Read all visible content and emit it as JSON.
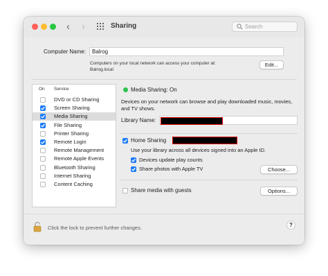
{
  "window": {
    "title": "Sharing"
  },
  "toolbar": {
    "back_icon": "‹",
    "forward_icon": "›"
  },
  "search": {
    "placeholder": "Search"
  },
  "computer_name": {
    "label": "Computer Name:",
    "value": "Balrog",
    "description_line1": "Computers on your local network can access your computer at:",
    "description_line2": "Balrog.local",
    "edit_button": "Edit..."
  },
  "services": {
    "col_on": "On",
    "col_service": "Service",
    "items": [
      {
        "label": "DVD or CD Sharing",
        "checked": false
      },
      {
        "label": "Screen Sharing",
        "checked": true
      },
      {
        "label": "Media Sharing",
        "checked": true,
        "selected": true
      },
      {
        "label": "File Sharing",
        "checked": true
      },
      {
        "label": "Printer Sharing",
        "checked": false
      },
      {
        "label": "Remote Login",
        "checked": true
      },
      {
        "label": "Remote Management",
        "checked": false
      },
      {
        "label": "Remote Apple Events",
        "checked": false
      },
      {
        "label": "Bluetooth Sharing",
        "checked": false
      },
      {
        "label": "Internet Sharing",
        "checked": false
      },
      {
        "label": "Content Caching",
        "checked": false
      }
    ]
  },
  "media_sharing": {
    "status": "Media Sharing: On",
    "status_color": "#30c150",
    "description": "Devices on your network can browse and play downloaded music, movies, and TV shows.",
    "library_label": "Library Name:",
    "home_sharing_label": "Home Sharing",
    "home_sharing_description": "Use your library across all devices signed into an Apple ID.",
    "devices_update_label": "Devices update play counts",
    "share_photos_label": "Share photos with Apple TV",
    "choose_button": "Choose...",
    "share_guests_label": "Share media with guests",
    "options_button": "Options..."
  },
  "footer": {
    "lock_text": "Click the lock to prevent further changes.",
    "help_label": "?"
  }
}
